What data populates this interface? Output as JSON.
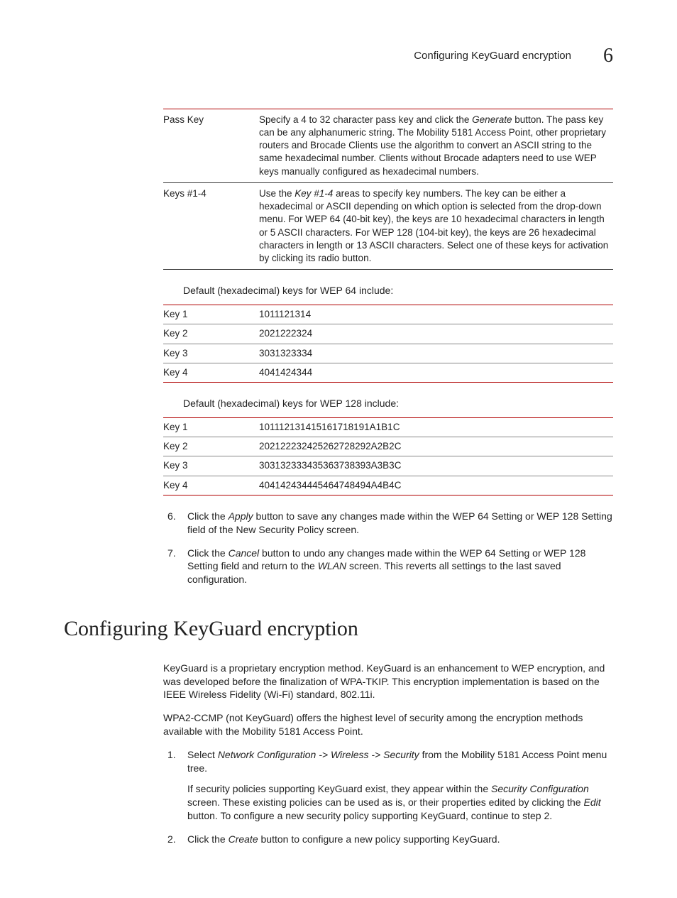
{
  "header": {
    "title": "Configuring KeyGuard encryption",
    "chapter": "6"
  },
  "table1": {
    "rows": [
      {
        "label": "Pass Key",
        "pre": "Specify a 4 to 32 character pass key and click the ",
        "em": "Generate",
        "post": " button. The pass key can be any alphanumeric string. The Mobility 5181 Access Point, other proprietary routers and Brocade Clients use the algorithm to convert an ASCII string to the same hexadecimal number. Clients without Brocade adapters need to use WEP keys manually configured as hexadecimal numbers."
      },
      {
        "label": "Keys #1-4",
        "pre": "Use the ",
        "em": "Key #1-4",
        "post": " areas to specify key numbers. The key can be either a hexadecimal or ASCII depending on which option is selected from the drop-down menu. For WEP 64 (40-bit key), the keys are 10 hexadecimal characters in length or 5 ASCII characters. For WEP 128 (104-bit key), the keys are 26 hexadecimal characters in length or 13 ASCII characters. Select one of these keys for activation by clicking its radio button."
      }
    ]
  },
  "caption1": "Default (hexadecimal) keys for WEP 64 include:",
  "wep64": [
    {
      "label": "Key 1",
      "value": "1011121314"
    },
    {
      "label": "Key 2",
      "value": "2021222324"
    },
    {
      "label": "Key 3",
      "value": "3031323334"
    },
    {
      "label": "Key 4",
      "value": "4041424344"
    }
  ],
  "caption2": "Default (hexadecimal) keys for WEP 128 include:",
  "wep128": [
    {
      "label": "Key 1",
      "value": "101112131415161718191A1B1C"
    },
    {
      "label": "Key 2",
      "value": "202122232425262728292A2B2C"
    },
    {
      "label": "Key 3",
      "value": "303132333435363738393A3B3C"
    },
    {
      "label": "Key 4",
      "value": "404142434445464748494A4B4C"
    }
  ],
  "steps1": [
    {
      "num": "6.",
      "pre": "Click the ",
      "em": "Apply",
      "post": " button to save any changes made within the WEP 64 Setting or WEP 128 Setting field of the New Security Policy screen."
    },
    {
      "num": "7.",
      "pre": "Click the ",
      "em": "Cancel",
      "mid": " button to undo any changes made within the WEP 64 Setting or WEP 128 Setting field and return to the ",
      "em2": "WLAN",
      "post": " screen. This reverts all settings to the last saved configuration."
    }
  ],
  "section_title": "Configuring KeyGuard encryption",
  "para1": "KeyGuard is a proprietary encryption method. KeyGuard is an enhancement to WEP encryption, and was developed before the finalization of WPA-TKIP. This encryption implementation is based on the IEEE Wireless Fidelity (Wi-Fi) standard, 802.11i.",
  "para2": "WPA2-CCMP (not KeyGuard) offers the highest level of security among the encryption methods available with the Mobility 5181 Access Point.",
  "steps2": [
    {
      "num": "1.",
      "pre": "Select ",
      "em": "Network Configuration -> Wireless -> Security",
      "post": " from the Mobility 5181 Access Point menu tree.",
      "sub_pre": "If security policies supporting KeyGuard exist, they appear within the ",
      "sub_em": "Security Configuration",
      "sub_mid": " screen. These existing policies can be used as is, or their properties edited by clicking the ",
      "sub_em2": "Edit",
      "sub_post": " button. To configure a new security policy supporting KeyGuard, continue to step 2."
    },
    {
      "num": "2.",
      "pre": "Click the ",
      "em": "Create",
      "post": " button to configure a new policy supporting KeyGuard."
    }
  ]
}
